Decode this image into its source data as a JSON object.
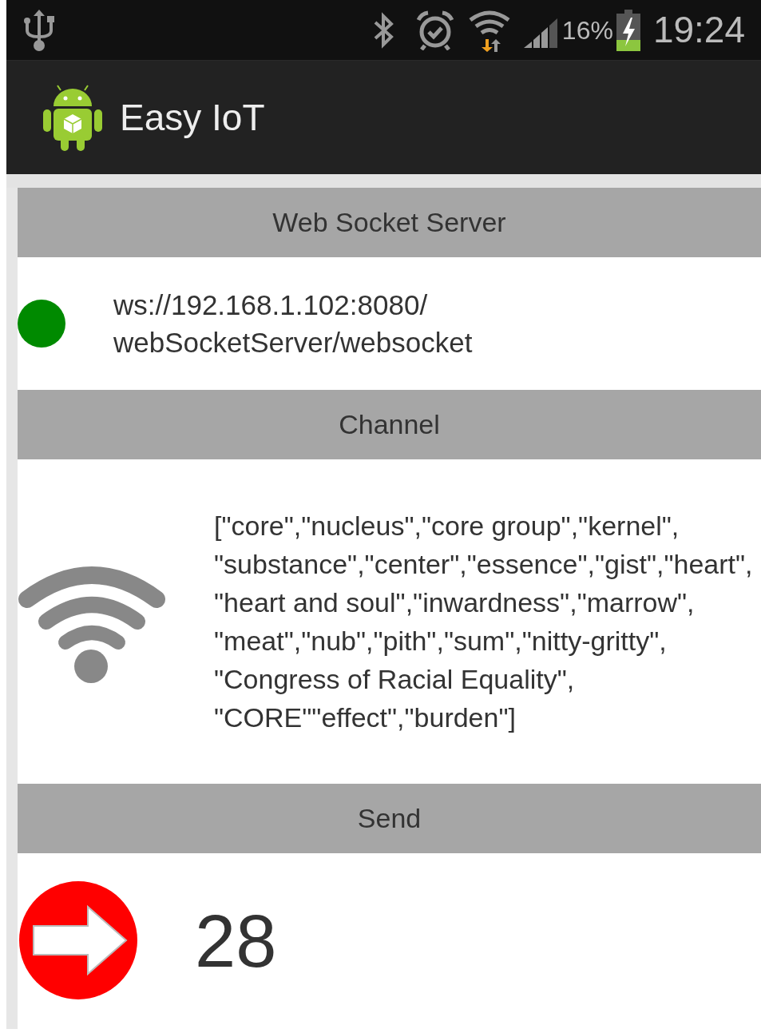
{
  "status_bar": {
    "battery_text": "16%",
    "time": "19:24"
  },
  "action_bar": {
    "title": "Easy IoT"
  },
  "sections": [
    {
      "kind": "server",
      "header": "Web Socket Server",
      "connected": true,
      "text": "ws://192.168.1.102:8080/webSocketServer/websocket"
    },
    {
      "kind": "channel",
      "header": "Channel",
      "text": "[\"core\",\"nucleus\",\"core group\",\"kernel\",\"substance\",\"center\",\"essence\",\"gist\",\"heart\",\"heart and soul\",\"inwardness\",\"marrow\",\"meat\",\"nub\",\"pith\",\"sum\",\"nitty-gritty\",\"Congress of Racial Equality\",\"CORE\"\"effect\",\"burden\"]"
    },
    {
      "kind": "send",
      "header": "Send",
      "text": "28"
    }
  ]
}
